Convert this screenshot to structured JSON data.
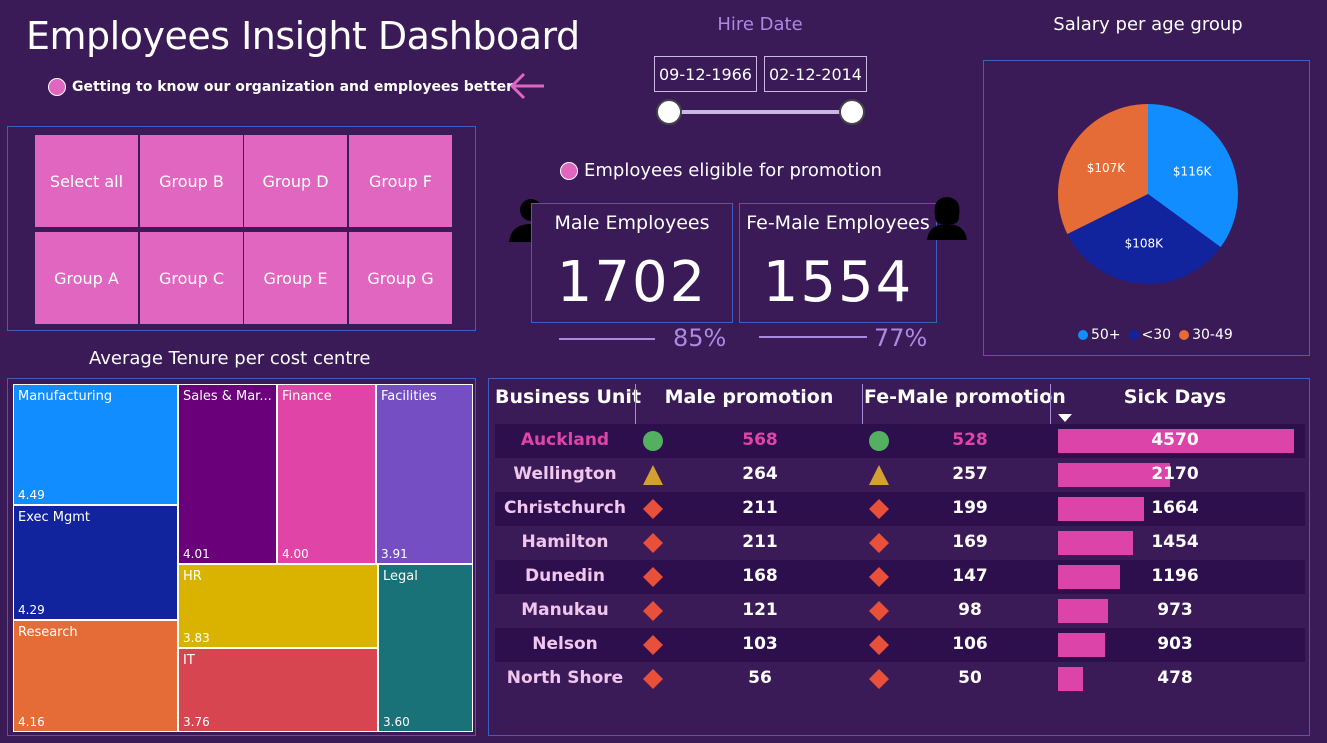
{
  "header": {
    "title": "Employees Insight Dashboard",
    "subtitle": "Getting to know our organization and employees better"
  },
  "slicer": {
    "buttons": [
      "Select all",
      "Group B",
      "Group D",
      "Group F",
      "Group A",
      "Group C",
      "Group E",
      "Group G"
    ]
  },
  "hire_date": {
    "label": "Hire Date",
    "start": "09-12-1966",
    "end": "02-12-2014"
  },
  "promotion": {
    "label": "Employees eligible for promotion",
    "male_title": "Male Employees",
    "male_value": "1702",
    "male_pct": "85%",
    "female_title": "Fe-Male Employees",
    "female_value": "1554",
    "female_pct": "77%"
  },
  "chart_data": [
    {
      "type": "pie",
      "title": "Salary per age group",
      "slices": [
        {
          "label": "50+",
          "value": 116,
          "display": "$116K",
          "color": "#118dff"
        },
        {
          "label": "<30",
          "value": 108,
          "display": "$108K",
          "color": "#12239e"
        },
        {
          "label": "30-49",
          "value": 107,
          "display": "$107K",
          "color": "#e66c37"
        }
      ],
      "legend": [
        "50+",
        "<30",
        "30-49"
      ]
    },
    {
      "type": "treemap",
      "title": "Average Tenure per cost centre",
      "items": [
        {
          "name": "Manufacturing",
          "value": "4.49",
          "color": "#118dff"
        },
        {
          "name": "Exec Mgmt",
          "value": "4.29",
          "color": "#12239e"
        },
        {
          "name": "Research",
          "value": "4.16",
          "color": "#e66c37"
        },
        {
          "name": "Sales & Mar...",
          "value": "4.01",
          "color": "#6b007b"
        },
        {
          "name": "Finance",
          "value": "4.00",
          "color": "#e044a7"
        },
        {
          "name": "Facilities",
          "value": "3.91",
          "color": "#744ec2"
        },
        {
          "name": "HR",
          "value": "3.83",
          "color": "#d9b300"
        },
        {
          "name": "IT",
          "value": "3.76",
          "color": "#d64550"
        },
        {
          "name": "Legal",
          "value": "3.60",
          "color": "#197278"
        }
      ]
    }
  ],
  "table": {
    "headers": [
      "Business Unit",
      "Male promotion",
      "Fe-Male promotion",
      "Sick Days"
    ],
    "rows": [
      {
        "unit": "Auckland",
        "male": "568",
        "male_icon": "green-circle",
        "female": "528",
        "female_icon": "green-circle",
        "sick": "4570",
        "sick_value": 4570
      },
      {
        "unit": "Wellington",
        "male": "264",
        "male_icon": "yellow-triangle",
        "female": "257",
        "female_icon": "yellow-triangle",
        "sick": "2170",
        "sick_value": 2170
      },
      {
        "unit": "Christchurch",
        "male": "211",
        "male_icon": "red-diamond",
        "female": "199",
        "female_icon": "red-diamond",
        "sick": "1664",
        "sick_value": 1664
      },
      {
        "unit": "Hamilton",
        "male": "211",
        "male_icon": "red-diamond",
        "female": "169",
        "female_icon": "red-diamond",
        "sick": "1454",
        "sick_value": 1454
      },
      {
        "unit": "Dunedin",
        "male": "168",
        "male_icon": "red-diamond",
        "female": "147",
        "female_icon": "red-diamond",
        "sick": "1196",
        "sick_value": 1196
      },
      {
        "unit": "Manukau",
        "male": "121",
        "male_icon": "red-diamond",
        "female": "98",
        "female_icon": "red-diamond",
        "sick": "973",
        "sick_value": 973
      },
      {
        "unit": "Nelson",
        "male": "103",
        "male_icon": "red-diamond",
        "female": "106",
        "female_icon": "red-diamond",
        "sick": "903",
        "sick_value": 903
      },
      {
        "unit": "North Shore",
        "male": "56",
        "male_icon": "red-diamond",
        "female": "50",
        "female_icon": "red-diamond",
        "sick": "478",
        "sick_value": 478
      }
    ]
  },
  "colors": {
    "background": "#3a1a57",
    "accent": "#e066c0",
    "bar": "#dd44aa",
    "highlight_text": "#e044a7"
  }
}
